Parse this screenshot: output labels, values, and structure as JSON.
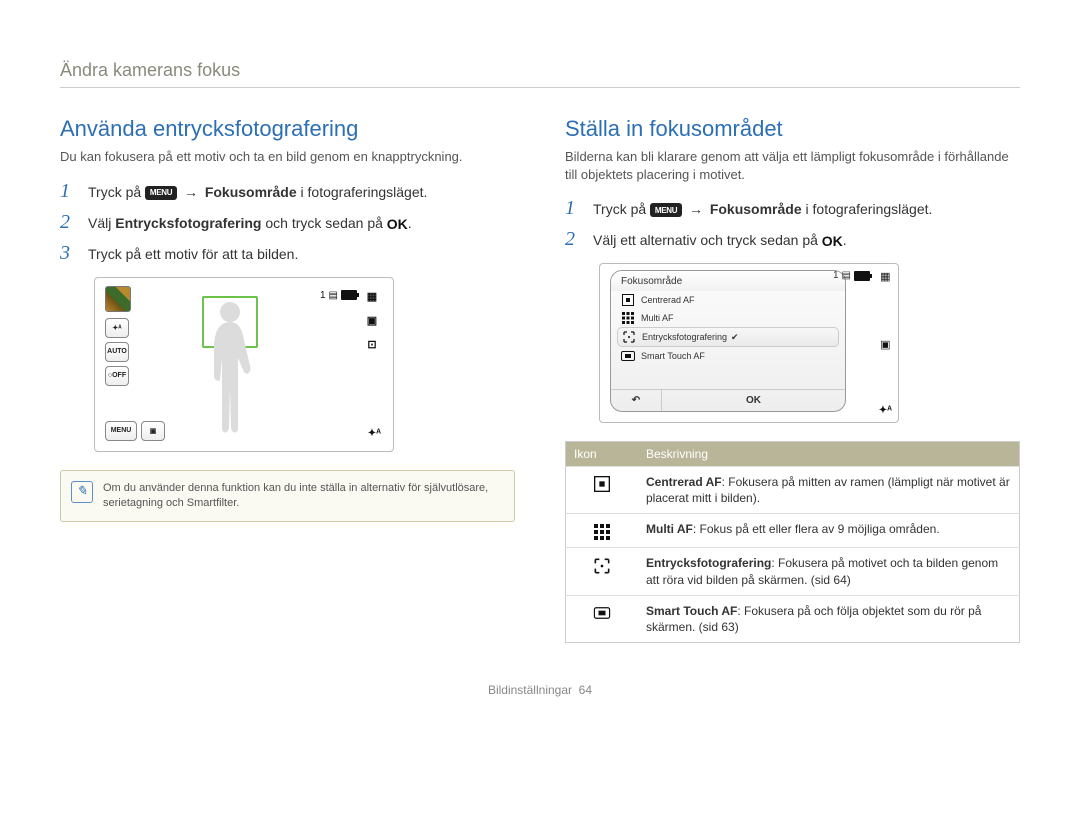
{
  "header": "Ändra kamerans fokus",
  "footer_label": "Bildinställningar",
  "page_number": "64",
  "left": {
    "title": "Använda entrycksfotografering",
    "intro": "Du kan fokusera på ett motiv och ta en bild genom en knapptryckning.",
    "steps": {
      "s1_pre": "Tryck på ",
      "s1_menu": "MENU",
      "s1_arrow": "→",
      "s1_bold": "Fokusområde",
      "s1_post": " i fotograferingsläget.",
      "s2_pre": "Välj ",
      "s2_bold": "Entrycksfotografering",
      "s2_mid": " och tryck sedan på ",
      "s2_ok": "OK",
      "s2_post": ".",
      "s3": "Tryck på ett motiv för att ta bilden."
    },
    "lcd": {
      "status_one": "1",
      "side_left": [
        "✦ᴬ",
        "AUTO",
        "○OFF"
      ],
      "menu_label": "MENU",
      "flash_label": "✦ᴬ"
    },
    "note": "Om du använder denna funktion kan du inte ställa in alternativ för självutlösare, serietagning och Smartfilter."
  },
  "right": {
    "title": "Ställa in fokusområdet",
    "intro": "Bilderna kan bli klarare genom att välja ett lämpligt fokusområde i förhållande till objektets placering i motivet.",
    "steps": {
      "s1_pre": "Tryck på ",
      "s1_menu": "MENU",
      "s1_arrow": "→",
      "s1_bold": "Fokusområde",
      "s1_post": " i fotograferingsläget.",
      "s2_pre": "Välj ett alternativ och tryck sedan på ",
      "s2_ok": "OK",
      "s2_post": "."
    },
    "menu": {
      "title": "Fokusområde",
      "items": [
        "Centrerad AF",
        "Multi AF",
        "Entrycksfotografering",
        "Smart Touch AF"
      ],
      "selected_index": 2,
      "back": "↶",
      "ok": "OK",
      "status_one": "1",
      "flash_label": "✦ᴬ"
    },
    "table": {
      "head_icon": "Ikon",
      "head_desc": "Beskrivning",
      "rows": [
        {
          "bold": "Centrerad AF",
          "rest": ": Fokusera på mitten av ramen (lämpligt när motivet är placerat mitt i bilden)."
        },
        {
          "bold": "Multi AF",
          "rest": ": Fokus på ett eller flera av 9 möjliga områden."
        },
        {
          "bold": "Entrycksfotografering",
          "rest": ": Fokusera på motivet och ta bilden genom att röra vid bilden på skärmen. (sid 64)"
        },
        {
          "bold": "Smart Touch AF",
          "rest": ": Fokusera på och följa objektet som du rör på skärmen. (sid 63)"
        }
      ]
    }
  }
}
